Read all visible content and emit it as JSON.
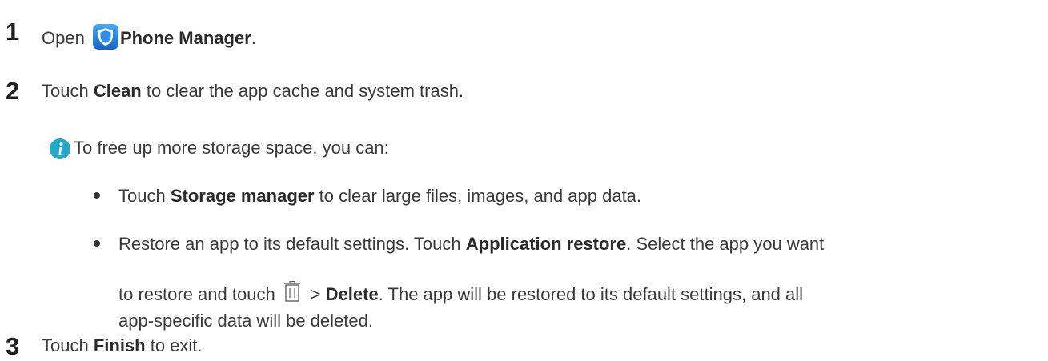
{
  "steps": [
    {
      "number": "1",
      "prefix": "Open ",
      "bold": "Phone Manager",
      "suffix": ".",
      "icon": "phone-manager-shield-icon"
    },
    {
      "number": "2",
      "prefix": "Touch ",
      "bold": "Clean",
      "suffix": " to clear the app cache and system trash."
    },
    {
      "number": "3",
      "prefix": "Touch ",
      "bold": "Finish",
      "suffix": " to exit."
    }
  ],
  "note": {
    "icon": "info-icon",
    "intro": "To free up more storage space, you can:",
    "bullets": [
      {
        "prefix": "Touch ",
        "bold": "Storage manager",
        "suffix": " to clear large files, images, and app data."
      },
      {
        "line1_prefix": "Restore an app to its default settings. Touch ",
        "line1_bold": "Application restore",
        "line1_suffix": ". Select the app you want",
        "line2_prefix": "to restore and touch",
        "line2_icon": "trash-icon",
        "line2_gt": "> ",
        "line2_bold": "Delete",
        "line2_suffix": ". The app will be restored to its default settings, and all",
        "line3": "app-specific data will be deleted."
      }
    ]
  },
  "colors": {
    "text": "#3a3a3a",
    "step_number": "#1f1f1f",
    "icon_blue": "#1e88e5",
    "info_teal": "#26a9c9"
  }
}
